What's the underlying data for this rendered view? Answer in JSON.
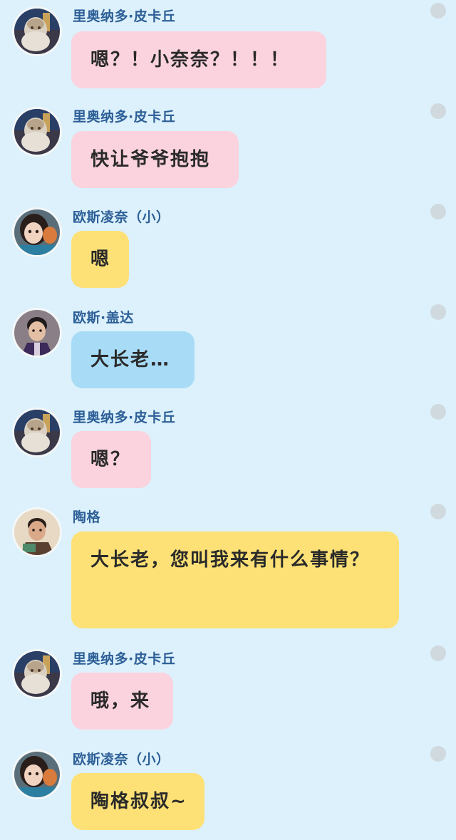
{
  "messages": [
    {
      "sender": "里奥纳多·皮卡丘",
      "text": "嗯？！小奈奈？！！！",
      "color": "pink",
      "avatar": "elder-avatar"
    },
    {
      "sender": "里奥纳多·皮卡丘",
      "text": "快让爷爷抱抱",
      "color": "pink",
      "avatar": "elder-avatar"
    },
    {
      "sender": "欧斯凌奈（小）",
      "text": "嗯",
      "color": "yellow",
      "avatar": "girl-avatar"
    },
    {
      "sender": "欧斯·盖达",
      "text": "大长老…",
      "color": "blue",
      "avatar": "man-avatar"
    },
    {
      "sender": "里奥纳多·皮卡丘",
      "text": "嗯？",
      "color": "pink",
      "avatar": "elder-avatar"
    },
    {
      "sender": "陶格",
      "text": "大长老，您叫我来有什么事情？",
      "color": "yellow",
      "avatar": "tao-avatar"
    },
    {
      "sender": "里奥纳多·皮卡丘",
      "text": "哦，来",
      "color": "pink",
      "avatar": "elder-avatar"
    },
    {
      "sender": "欧斯凌奈（小）",
      "text": "陶格叔叔~",
      "color": "yellow",
      "avatar": "girl-avatar"
    }
  ],
  "colors": {
    "background": "#dcf1fb",
    "pink": "#fbd3de",
    "yellow": "#fde176",
    "blue": "#a8dcf6",
    "name": "#2d5f97"
  }
}
